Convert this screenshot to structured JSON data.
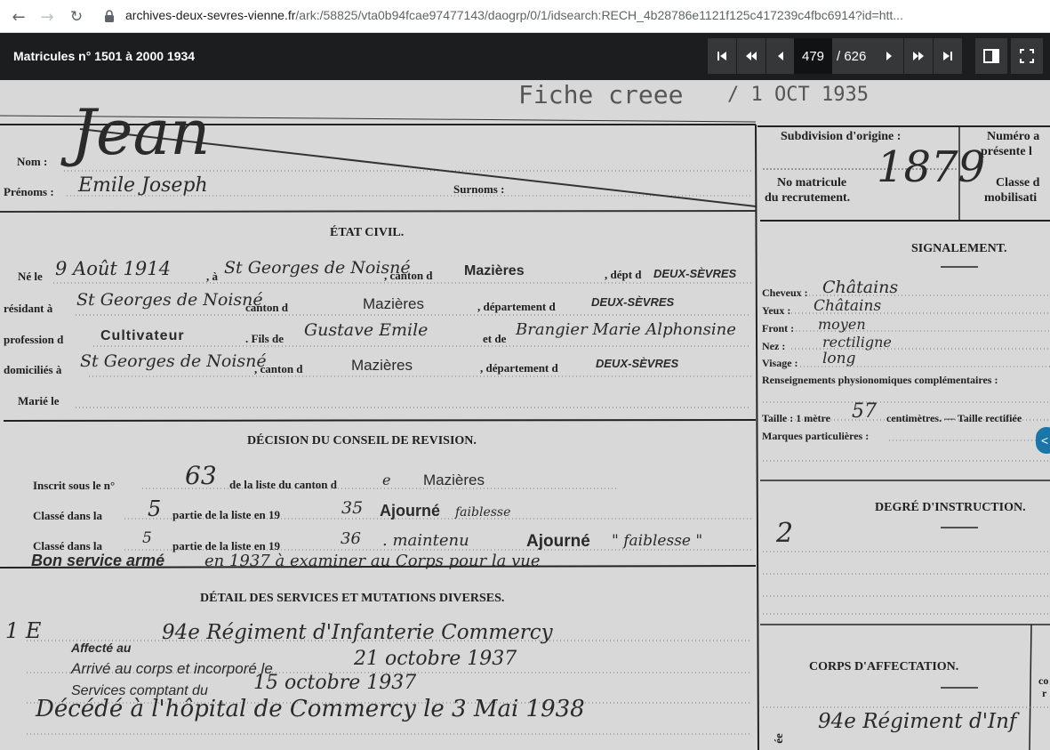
{
  "browser": {
    "url_domain": "archives-deux-sevres-vienne.fr",
    "url_path": "/ark:/58825/vta0b94fcae97477143/daogrp/0/1/idsearch:RECH_4b28786e1121f125c417239c4fbc6914?id=htt..."
  },
  "viewer": {
    "title": "Matricules n° 1501 à 2000 1934",
    "current_page": "479",
    "total_pages": "/ 626",
    "icons": [
      "first-page-icon",
      "previous-ten-icon",
      "previous-page-icon",
      "next-page-icon",
      "next-ten-icon",
      "last-page-icon",
      "sidebar-panel-icon",
      "fullscreen-icon"
    ]
  },
  "document": {
    "stamp_top": "Fiche  creee",
    "stamp_date": "/ 1 OCT 1935",
    "name_label": "Nom :",
    "name_value": "Jean",
    "prenoms_label": "Prénoms :",
    "prenoms_value": "Emile Joseph",
    "surnoms_label": "Surnoms :",
    "etat_civil": "ÉTAT CIVIL.",
    "ne_label": "Né le",
    "birth_date": "9 Août 1914",
    "birth_a": ", à",
    "birth_place": "St Georges de Noisné",
    "canton_label": ", canton d",
    "canton_value": "Mazières",
    "dept_label": ", dépt d",
    "dept_value": "DEUX-SÈVRES",
    "resident_label": "résidant à",
    "resident_value": "St Georges de Noisné",
    "resident_canton_label": "canton d",
    "resident_canton_value": "Mazières",
    "resident_dept_label": ", département d",
    "resident_dept_value": "DEUX-SÈVRES",
    "profession_label": "profession d",
    "profession_value": "Cultivateur",
    "fils_label": ". Fils de",
    "father": "Gustave Emile",
    "mother_label": "et de",
    "mother": "Brangier Marie Alphonsine",
    "domicile_label": "domiciliés à",
    "domicile_value": "St Georges de Noisné",
    "domicile_canton_label": ", canton d",
    "domicile_canton_value": "Mazières",
    "domicile_dept_label": ", département d",
    "domicile_dept_value": "DEUX-SÈVRES",
    "marie_label": "Marié le",
    "decision_title": "DÉCISION DU CONSEIL DE REVISION.",
    "inscrit_label": "Inscrit sous le n°",
    "inscrit_num": "63",
    "inscrit_suffix": "de la liste du canton d",
    "inscrit_e": "e",
    "inscrit_canton": "Mazières",
    "classe1_label": "Classé dans la",
    "classe1_part": "5",
    "classe1_mid": "partie de la liste en 19",
    "classe1_year": "35",
    "classe1_decision": "Ajourné",
    "classe1_note": "faiblesse",
    "classe2_label": "Classé dans la",
    "classe2_part": "5",
    "classe2_mid": "partie de la liste en 19",
    "classe2_year": "36",
    "classe2_maintenu": ". maintenu",
    "classe2_decision": "Ajourné",
    "classe2_note": "\" faiblesse \"",
    "bon_service": "Bon service armé",
    "bon_service_note": "en 1937 à examiner au Corps pour la vue",
    "detail_title": "DÉTAIL DES SERVICES ET MUTATIONS DIVERSES.",
    "margin_note": "1 E",
    "affecte_label": "Affecté au",
    "affecte_value": "94e Régiment d'Infanterie Commercy",
    "arrive_label": "Arrivé au corps et incorporé le",
    "arrive_value": "21 octobre 1937",
    "services_label": "Services comptant du",
    "services_value": "15 octobre 1937",
    "deces_value": "Décédé à l'hôpital de Commercy le 3 Mai 1938",
    "subdivision_label": "Subdivision d'origine :",
    "numero_label_1": "Numéro a",
    "numero_label_2": "présente l",
    "matricule_label_1": "No matricule",
    "matricule_label_2": "du recrutement.",
    "matricule_value": "1879",
    "classe_label_1": "Classe d",
    "classe_label_2": "mobilisati",
    "signalement_title": "SIGNALEMENT.",
    "cheveux_label": "Cheveux :",
    "cheveux_value": "Châtains",
    "yeux_label": "Yeux :",
    "yeux_value": "Châtains",
    "front_label": "Front :",
    "front_value": "moyen",
    "nez_label": "Nez :",
    "nez_value": "rectiligne",
    "visage_label": "Visage :",
    "visage_value": "long",
    "renseignements_label": "Renseignements physionomiques complémentaires :",
    "taille_label": "Taille : 1 mètre",
    "taille_value": "57",
    "taille_suffix": "centimètres. — Taille rectifiée",
    "marques_label": "Marques particulières :",
    "degre_title": "DEGRÉ D'INSTRUCTION.",
    "degre_value": "2",
    "corps_title": "CORPS D'AFFECTATION.",
    "corps_value": "94e Régiment d'Inf",
    "corps_side_1": "co",
    "corps_side_2": "r",
    "vertical_note": "ée",
    "toggle_glyph": "<"
  }
}
